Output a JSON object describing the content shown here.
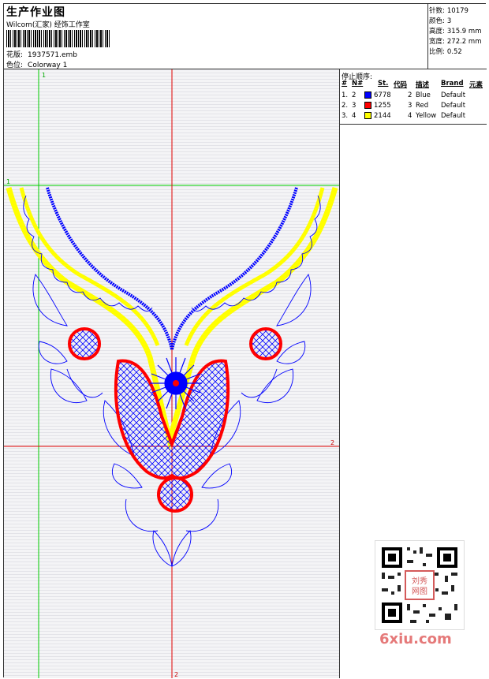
{
  "header": {
    "title": "生产作业图",
    "subtitle": "Wilcom(汇家) 经饰工作室",
    "design_label": "花版:",
    "design_value": "1937571.emb",
    "colorway_label": "色位:",
    "colorway_value": "Colorway 1"
  },
  "stats": [
    {
      "label": "针数:",
      "value": "10179"
    },
    {
      "label": "颜色:",
      "value": "3"
    },
    {
      "label": "高度:",
      "value": "315.9 mm"
    },
    {
      "label": "宽度:",
      "value": "272.2 mm"
    },
    {
      "label": "比例:",
      "value": "0.52"
    }
  ],
  "stop_sequence": {
    "title": "停止顺序:",
    "headers": [
      "#",
      "N#",
      "St.",
      "代码",
      "描述",
      "Brand",
      "元素"
    ],
    "rows": [
      {
        "num": "1.",
        "n": "2",
        "color": "#0000ff",
        "stitches": "6778",
        "code": "2",
        "desc": "Blue",
        "brand": "Default"
      },
      {
        "num": "2.",
        "n": "3",
        "color": "#ff0000",
        "stitches": "1255",
        "code": "3",
        "desc": "Red",
        "brand": "Default"
      },
      {
        "num": "3.",
        "n": "4",
        "color": "#ffff00",
        "stitches": "2144",
        "code": "4",
        "desc": "Yellow",
        "brand": "Default"
      }
    ]
  },
  "canvas": {
    "markers": {
      "m1_top": "1",
      "m1_left": "1",
      "m2_right": "2",
      "m2_bottom": "2"
    }
  },
  "watermark": {
    "logo_text": "6xiu.com",
    "seal_text": "刘秀网图"
  },
  "colors": {
    "blue": "#0000ff",
    "red": "#ff0000",
    "yellow": "#ffff00",
    "green_guide": "#00cc00",
    "red_guide": "#e00000"
  }
}
